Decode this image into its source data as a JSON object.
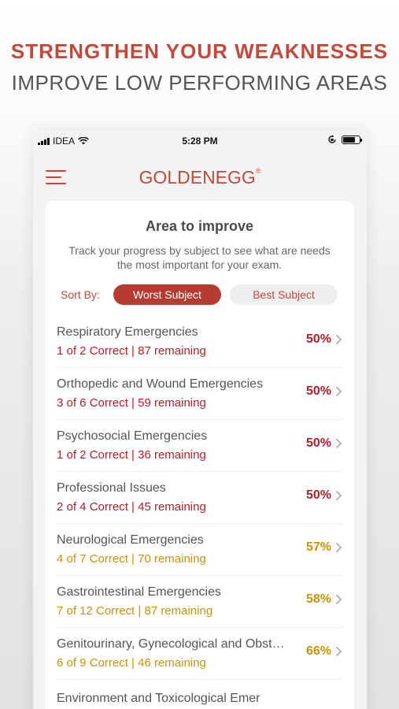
{
  "promo": {
    "headline": "STRENGTHEN YOUR WEAKNESSES",
    "subheadline": "IMPROVE LOW PERFORMING AREAS"
  },
  "status_bar": {
    "carrier": "IDEA",
    "time": "5:28 PM",
    "icons": [
      "signal-icon",
      "wifi-icon",
      "rotation-lock-icon",
      "battery-icon"
    ]
  },
  "app": {
    "logo": "GOLDENEGG",
    "logo_mark": "®"
  },
  "card": {
    "title": "Area to improve",
    "description": "Track your progress by subject to see what are needs the most important for your exam.",
    "sort_label": "Sort By:",
    "sort_worst": "Worst Subject",
    "sort_best": "Best Subject",
    "selected_sort": "Worst Subject"
  },
  "colors": {
    "accent": "#c24a3c",
    "low_score": "#b0202a",
    "mid_score": "#c9920c"
  },
  "subjects": [
    {
      "name": "Respiratory Emergencies",
      "stats": "1 of 2  Correct | 87 remaining",
      "percent": "50%",
      "level": "red"
    },
    {
      "name": "Orthopedic and Wound Emergencies",
      "stats": "3 of 6  Correct | 59 remaining",
      "percent": "50%",
      "level": "red"
    },
    {
      "name": "Psychosocial Emergencies",
      "stats": "1 of 2  Correct | 36 remaining",
      "percent": "50%",
      "level": "red"
    },
    {
      "name": "Professional Issues",
      "stats": "2 of 4  Correct | 45 remaining",
      "percent": "50%",
      "level": "red"
    },
    {
      "name": "Neurological Emergencies",
      "stats": "4 of 7  Correct | 70 remaining",
      "percent": "57%",
      "level": "gold"
    },
    {
      "name": "Gastrointestinal Emergencies",
      "stats": "7 of 12  Correct | 87 remaining",
      "percent": "58%",
      "level": "gold"
    },
    {
      "name": "Genitourinary, Gynecological and Obstetrical Emergencies",
      "stats": "6 of 9  Correct | 46 remaining",
      "percent": "66%",
      "level": "gold"
    },
    {
      "name": "Environment and Toxicological Emer",
      "stats": "",
      "percent": "",
      "level": "gold"
    }
  ]
}
